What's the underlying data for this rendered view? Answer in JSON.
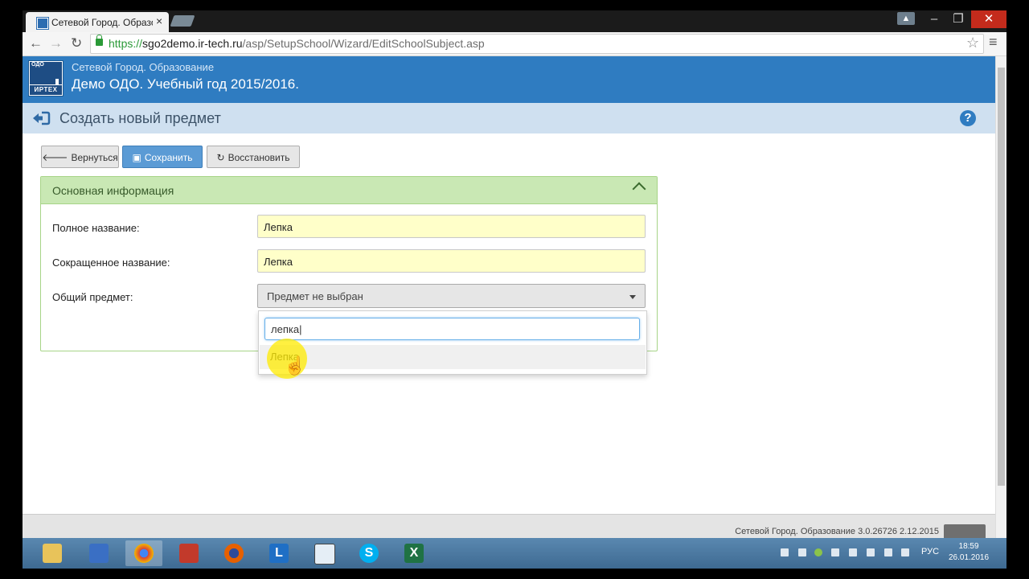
{
  "browser": {
    "tab_title": "Сетевой Город. Образов:",
    "url_https": "https://",
    "url_host": "sgo2demo.ir-tech.ru",
    "url_path": "/asp/SetupSchool/Wizard/EditSchoolSubject.asp"
  },
  "app": {
    "logo_top": "ОДО",
    "logo_bottom": "ИРТЕХ",
    "subtitle": "Сетевой Город. Образование",
    "title": "Демо ОДО. Учебный год 2015/2016."
  },
  "page": {
    "title": "Создать новый предмет",
    "help": "?"
  },
  "actions": {
    "back": "Вернуться",
    "save": "Сохранить",
    "restore": "Восстановить"
  },
  "panel": {
    "title": "Основная информация",
    "full_name_label": "Полное название:",
    "full_name_value": "Лепка",
    "short_name_label": "Сокращенное название:",
    "short_name_value": "Лепка",
    "common_subject_label": "Общий предмет:",
    "common_subject_value": "Предмет не выбран",
    "search_value": "лепка",
    "options": [
      "Лепка"
    ]
  },
  "footer": {
    "text": "Сетевой Город. Образование  3.0.26726  2.12.2015"
  },
  "taskbar": {
    "lang": "РУС",
    "time": "18:59",
    "date": "26.01.2016"
  },
  "colors": {
    "header_blue": "#2f7cc1",
    "panel_green": "#c9e8b4",
    "field_yellow": "#ffffc9"
  }
}
